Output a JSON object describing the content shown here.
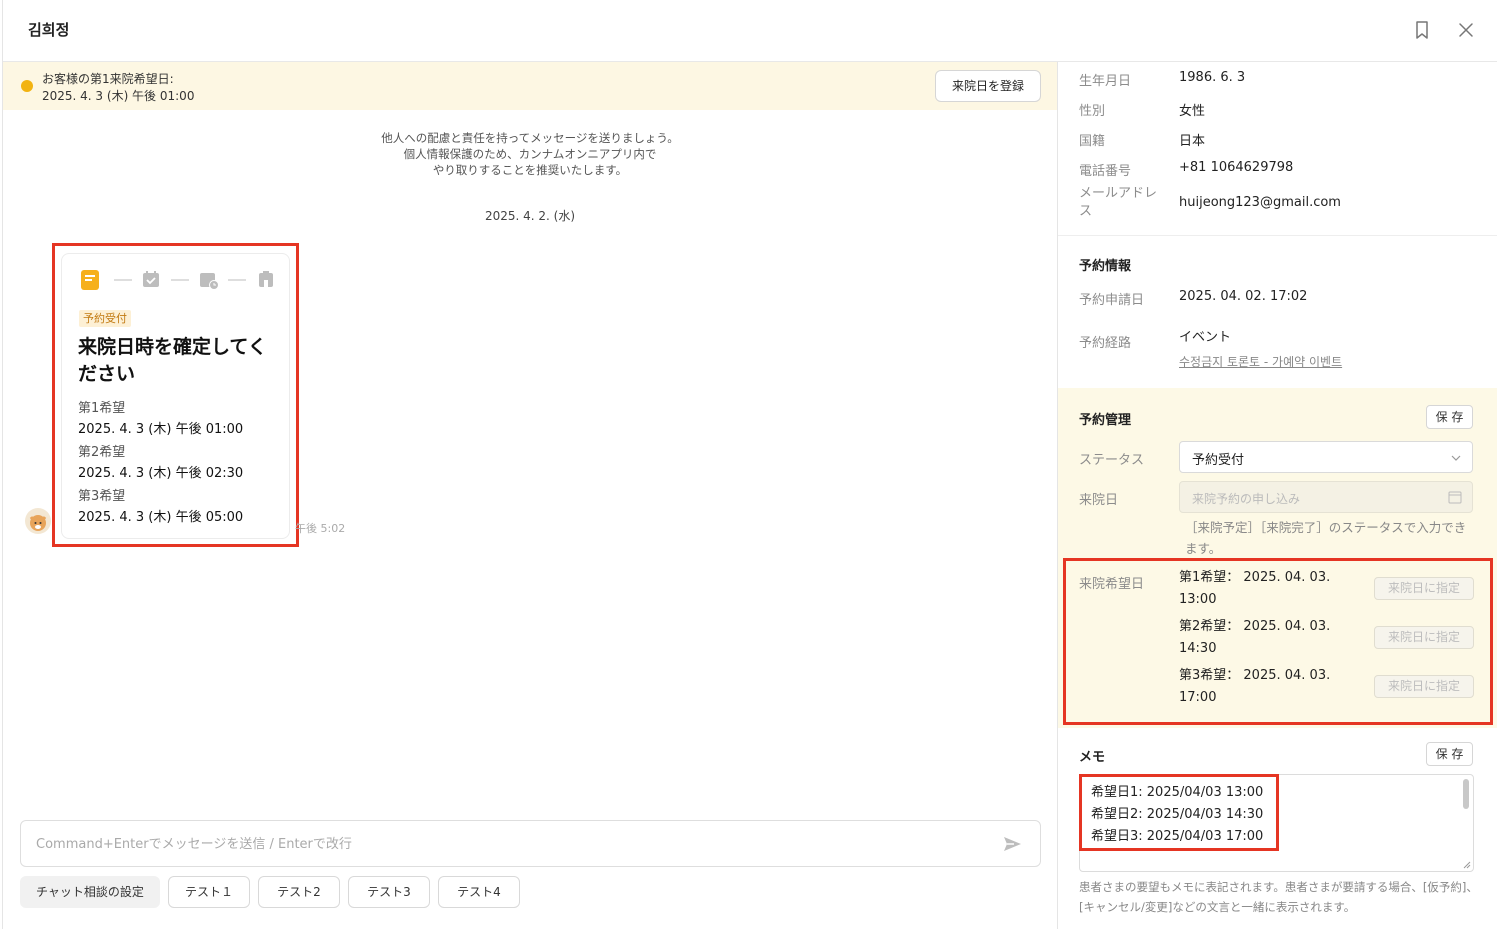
{
  "header": {
    "title": "김희정"
  },
  "notice": {
    "line1": "お客様の第1来院希望日:",
    "line2": "2025. 4. 3 (木) 午後 01:00",
    "register_button": "来院日を登録"
  },
  "chat": {
    "system_message": [
      "他人への配慮と責任を持ってメッセージを送りましょう。",
      "個人情報保護のため、カンナムオンニアプリ内で",
      "やり取りすることを推奨いたします。"
    ],
    "date_separator": "2025. 4. 2. (水)",
    "card": {
      "badge": "予約受付",
      "headline": "来院日時を確定してください",
      "preferences": [
        {
          "label": "第1希望",
          "value": "2025. 4. 3 (木) 午後 01:00"
        },
        {
          "label": "第2希望",
          "value": "2025. 4. 3 (木) 午後 02:30"
        },
        {
          "label": "第3希望",
          "value": "2025. 4. 3 (木) 午後 05:00"
        }
      ]
    },
    "message_time": "午後 5:02",
    "input_placeholder": "Command+Enterでメッセージを送信 / Enterで改行",
    "quick_buttons": [
      "チャット相談の設定",
      "テスト１",
      "テスト2",
      "テスト3",
      "テスト4"
    ]
  },
  "profile": {
    "fields": [
      {
        "label": "生年月日",
        "value": "1986. 6. 3"
      },
      {
        "label": "性別",
        "value": "女性"
      },
      {
        "label": "国籍",
        "value": "日本"
      },
      {
        "label": "電話番号",
        "value": "+81 1064629798"
      },
      {
        "label": "メールアドレス",
        "value": "huijeong123@gmail.com"
      }
    ]
  },
  "reservation_info": {
    "title": "予約情報",
    "apply_date_label": "予約申請日",
    "apply_date_value": "2025. 04. 02. 17:02",
    "route_label": "予約経路",
    "route_value": "イベント",
    "route_link": "수정금지 토론토 - 가예약 이벤트"
  },
  "management": {
    "title": "予約管理",
    "save_label": "保 存",
    "status_label": "ステータス",
    "status_value": "予約受付",
    "visit_date_label": "来院日",
    "visit_date_placeholder": "来院予約の申し込み",
    "help_text": "［来院予定］［来院完了］のステータスで入力できます。",
    "preferred_label": "来院希望日",
    "preferred": [
      {
        "line1": "第1希望：  2025. 04. 03.",
        "line2": "13:00"
      },
      {
        "line1": "第2希望：  2025. 04. 03.",
        "line2": "14:30"
      },
      {
        "line1": "第3希望：  2025. 04. 03.",
        "line2": "17:00"
      }
    ],
    "assign_label": "来院日に指定"
  },
  "memo": {
    "title": "メモ",
    "save_label": "保 存",
    "lines": [
      "希望日1: 2025/04/03 13:00",
      "希望日2: 2025/04/03 14:30",
      "希望日3: 2025/04/03 17:00"
    ],
    "help_text": "患者さまの要望もメモに表記されます。患者さまが要請する場合、[仮予約]、[キャンセル/変更]などの文言と一緒に表示されます。"
  },
  "colors": {
    "accent_yellow": "#f2b311",
    "highlight_red": "#e53523",
    "notice_bg": "#fdf7e3"
  }
}
